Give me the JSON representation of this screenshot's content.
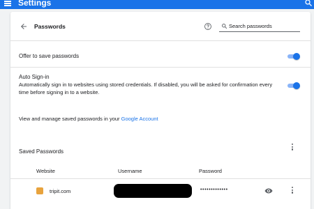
{
  "header": {
    "title": "Settings",
    "menu_icon": "menu-icon",
    "search_icon": "search-icon",
    "bar_color": "#1a73e8"
  },
  "passwords_page": {
    "title": "Passwords",
    "back_icon": "arrow-back-icon",
    "help_icon": "help-icon",
    "search_placeholder": "Search passwords",
    "search_value": ""
  },
  "settings": {
    "offer_to_save": {
      "label": "Offer to save passwords",
      "enabled": true
    },
    "auto_sign_in": {
      "label": "Auto Sign-in",
      "description": "Automatically sign in to websites using stored credentials. If disabled, you will be asked for confirmation every time before signing in to a website.",
      "enabled": true
    },
    "manage": {
      "text": "View and manage saved passwords in your ",
      "link": "Google Account"
    }
  },
  "saved_passwords": {
    "title": "Saved Passwords",
    "columns": [
      "Website",
      "Username",
      "Password"
    ],
    "rows": [
      {
        "website": "tripit.com",
        "username": "",
        "password": "•••••••••••••"
      }
    ]
  },
  "accent_color": "#1a73e8"
}
